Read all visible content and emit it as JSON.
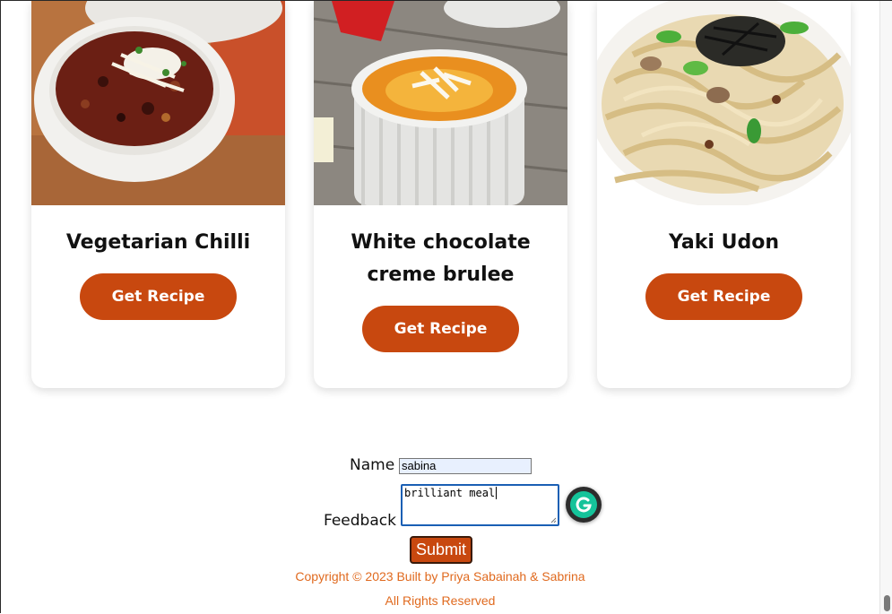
{
  "cards": [
    {
      "title": "Vegetarian Chilli",
      "button": "Get Recipe",
      "image_icon": "chilli-bowl-photo"
    },
    {
      "title": "White chocolate creme brulee",
      "button": "Get Recipe",
      "image_icon": "creme-brulee-photo"
    },
    {
      "title": "Yaki Udon",
      "button": "Get Recipe",
      "image_icon": "udon-noodles-photo"
    }
  ],
  "form": {
    "name_label": "Name",
    "name_value": "sabina",
    "feedback_label": "Feedback",
    "feedback_value": "brilliant meal",
    "submit_label": "Submit"
  },
  "footer": {
    "copyright": "Copyright © 2023 Built by Priya Sabainah & Sabrina",
    "rights": "All Rights Reserved"
  },
  "colors": {
    "accent": "#c8480f",
    "footer_text": "#e06a1f",
    "grammarly": "#15c39a"
  }
}
